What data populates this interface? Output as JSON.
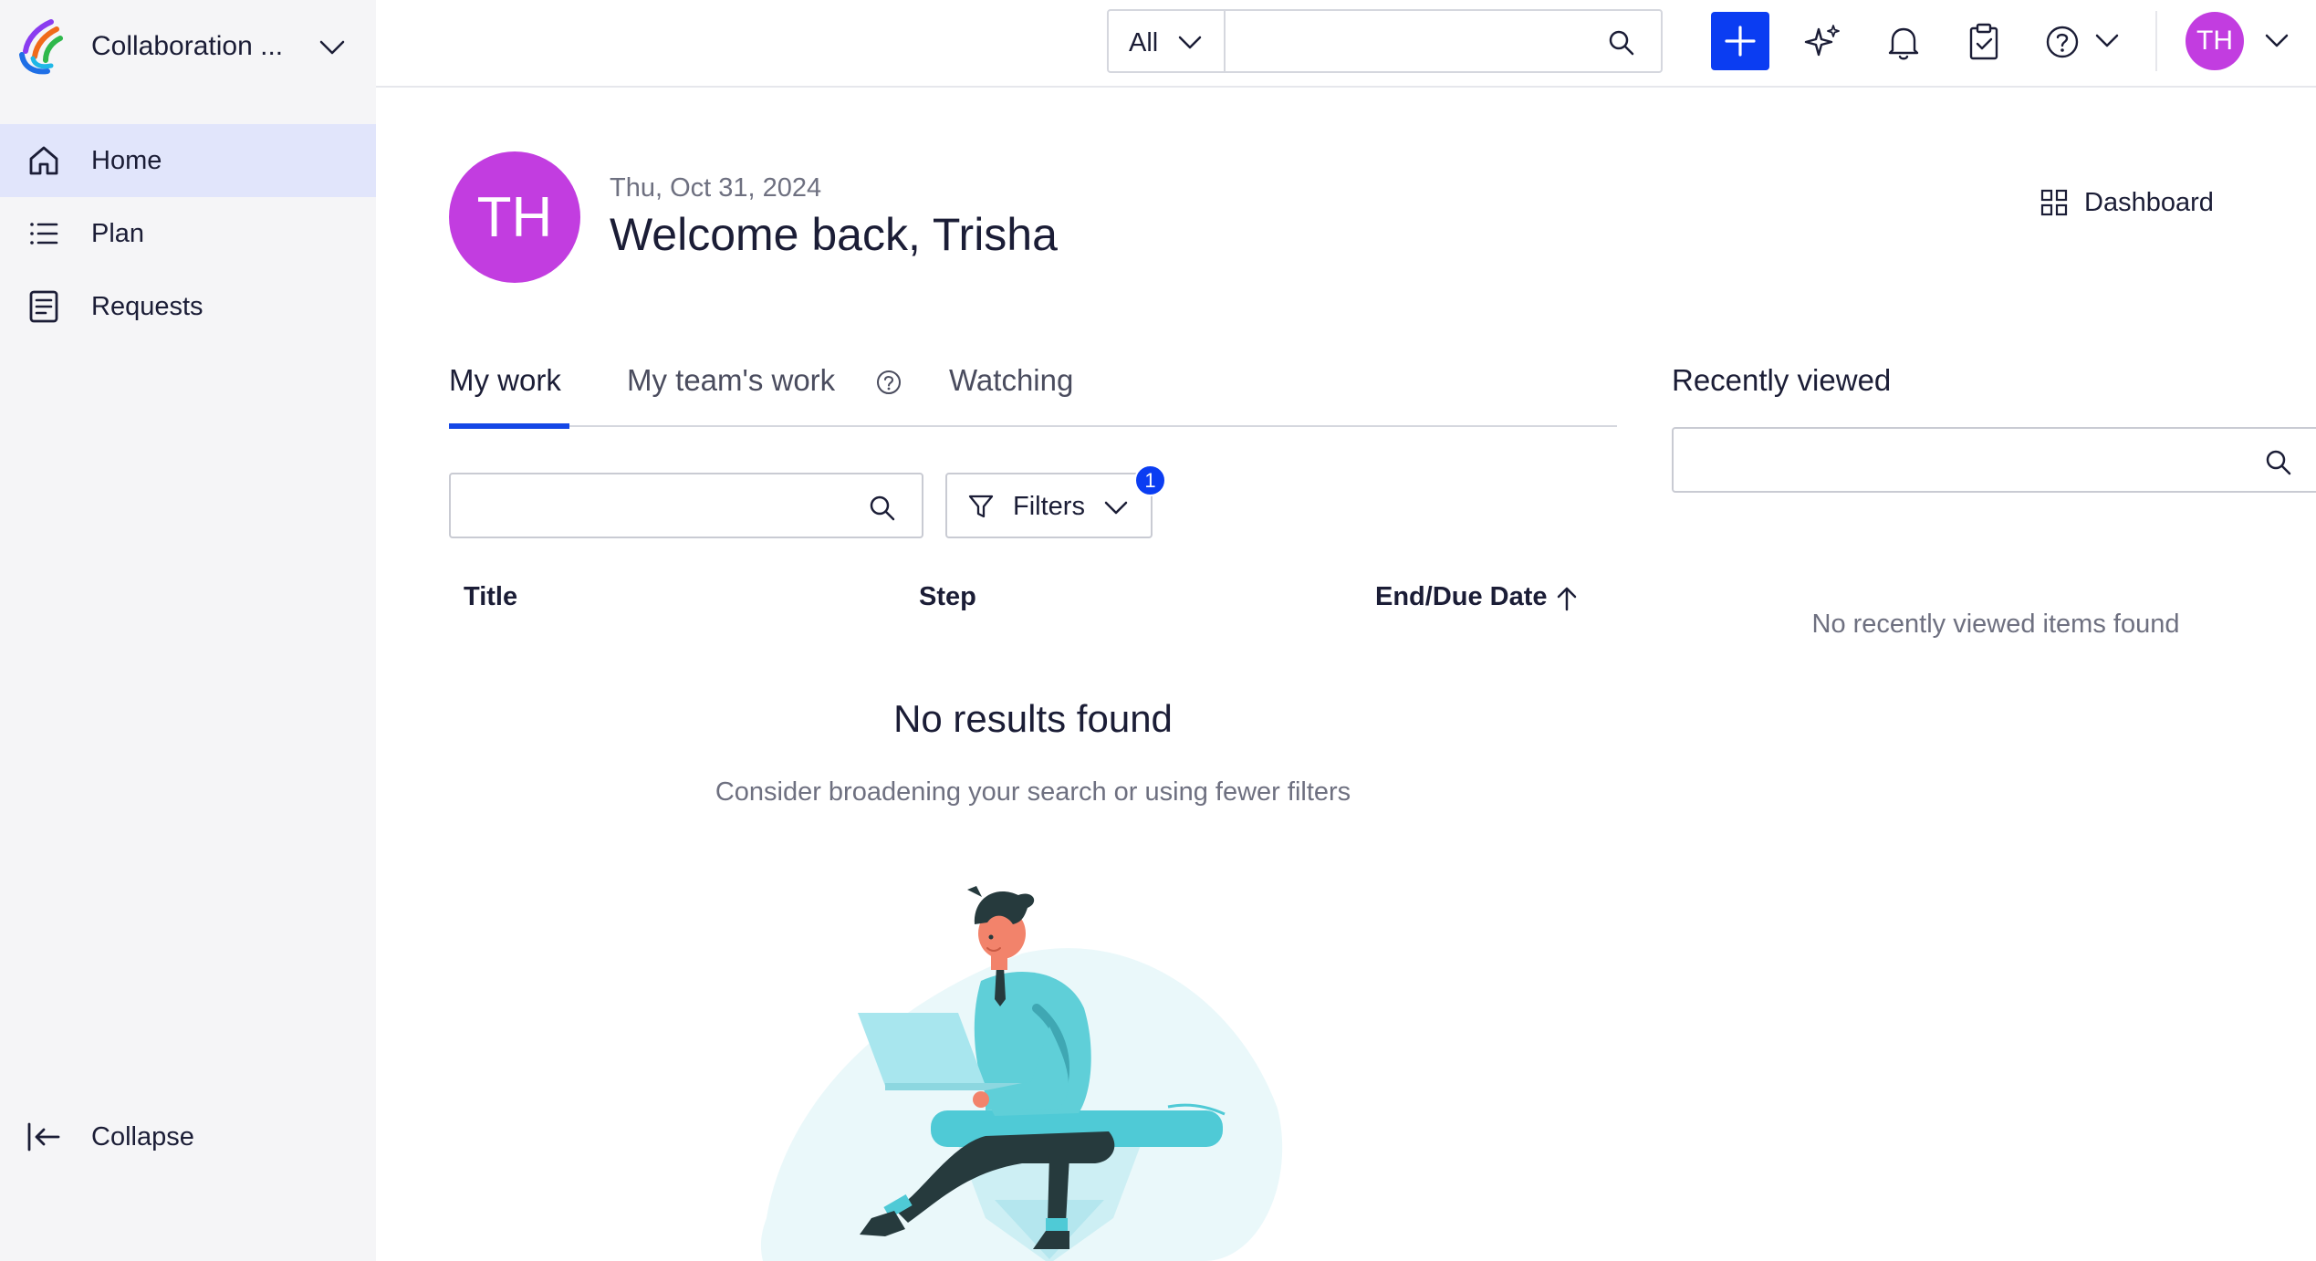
{
  "sidebar": {
    "workspace_name": "Collaboration ...",
    "items": [
      {
        "label": "Home",
        "icon": "home-icon",
        "active": true
      },
      {
        "label": "Plan",
        "icon": "list-icon",
        "active": false
      },
      {
        "label": "Requests",
        "icon": "document-icon",
        "active": false
      }
    ],
    "collapse_label": "Collapse"
  },
  "topbar": {
    "scope_label": "All",
    "search_value": "",
    "avatar_initials": "TH",
    "icons": [
      "plus-icon",
      "sparkle-icon",
      "bell-icon",
      "clipboard-check-icon",
      "help-icon",
      "chevron-down-icon"
    ]
  },
  "greeting": {
    "avatar_initials": "TH",
    "date": "Thu, Oct 31, 2024",
    "welcome": "Welcome back, Trisha",
    "dashboard_label": "Dashboard"
  },
  "tabs": [
    {
      "label": "My work",
      "active": true
    },
    {
      "label": "My team's work",
      "active": false
    },
    {
      "label": "Watching",
      "active": false
    }
  ],
  "work": {
    "search_value": "",
    "filters_label": "Filters",
    "filters_count": "1",
    "columns": [
      "Title",
      "Step",
      "End/Due Date"
    ],
    "empty_title": "No results found",
    "empty_subtitle": "Consider broadening your search or using fewer filters"
  },
  "recently_viewed": {
    "title": "Recently viewed",
    "search_value": "",
    "empty_text": "No recently viewed items found"
  },
  "colors": {
    "accent": "#0b3df2",
    "avatar": "#c23de0",
    "active_nav_bg": "#e1e5fb",
    "sidebar_bg": "#f5f5f7"
  }
}
